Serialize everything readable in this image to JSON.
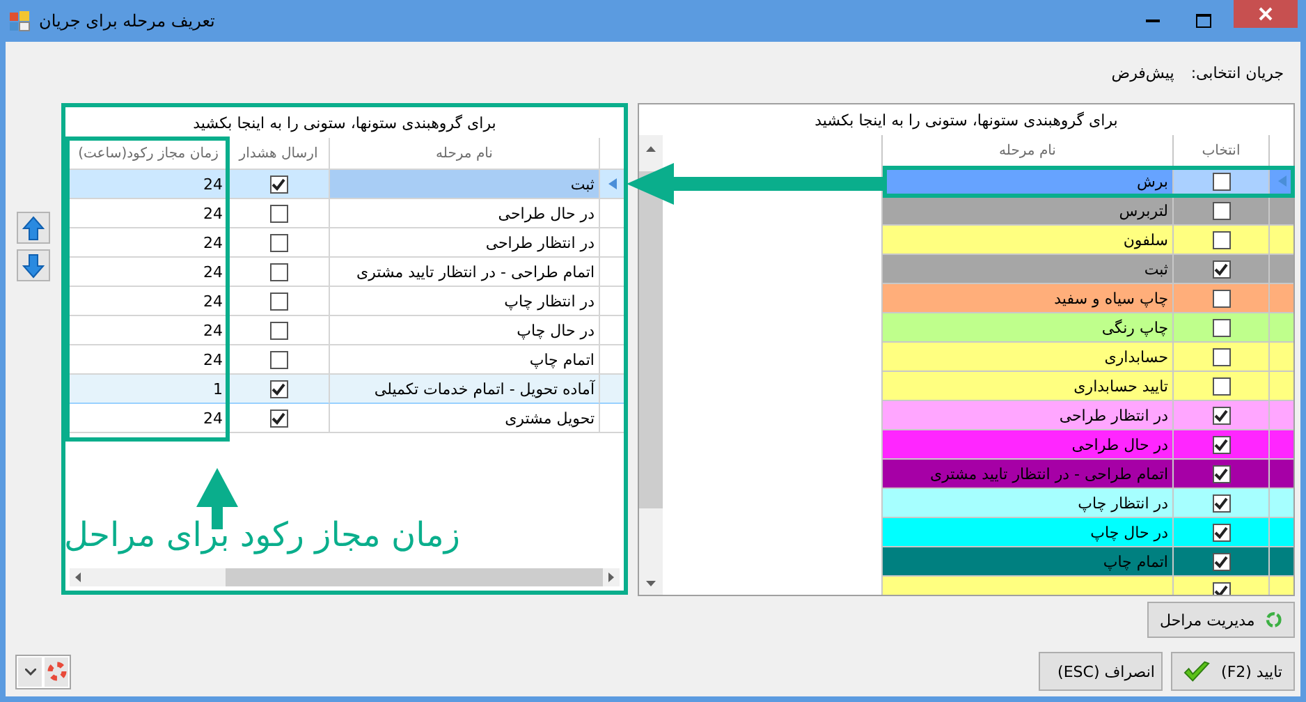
{
  "window": {
    "title": "تعریف مرحله برای جریان"
  },
  "flow": {
    "label": "جریان انتخابی:",
    "value": "پیش‌فرض"
  },
  "stages_grid": {
    "group_hint": "برای گروهبندی ستونها، ستونی را به اینجا بکشید",
    "columns": [
      "نام مرحله",
      "ارسال هشدار",
      "زمان مجاز رکود(ساعت)"
    ],
    "rows": [
      {
        "name": "ثبت",
        "alert": true,
        "hours": "24",
        "selected": true,
        "highlighted": false
      },
      {
        "name": "در حال طراحی",
        "alert": false,
        "hours": "24",
        "selected": false,
        "highlighted": false
      },
      {
        "name": "در انتظار طراحی",
        "alert": false,
        "hours": "24",
        "selected": false,
        "highlighted": false
      },
      {
        "name": "اتمام طراحی - در انتظار تایید مشتری",
        "alert": false,
        "hours": "24",
        "selected": false,
        "highlighted": false
      },
      {
        "name": "در انتظار چاپ",
        "alert": false,
        "hours": "24",
        "selected": false,
        "highlighted": false
      },
      {
        "name": "در حال چاپ",
        "alert": false,
        "hours": "24",
        "selected": false,
        "highlighted": false
      },
      {
        "name": "اتمام چاپ",
        "alert": false,
        "hours": "24",
        "selected": false,
        "highlighted": false
      },
      {
        "name": "آماده تحویل - اتمام خدمات تکمیلی",
        "alert": true,
        "hours": "1",
        "selected": false,
        "highlighted": true
      },
      {
        "name": "تحویل مشتری",
        "alert": true,
        "hours": "24",
        "selected": false,
        "highlighted": false
      }
    ]
  },
  "all_stages_grid": {
    "group_hint": "برای گروهبندی ستونها، ستونی را به اینجا بکشید",
    "columns": [
      "انتخاب",
      "نام مرحله"
    ],
    "rows": [
      {
        "name": "برش",
        "checked": false,
        "color": "#66a3ff",
        "selected": true
      },
      {
        "name": "لتربرس",
        "checked": false,
        "color": "#a6a6a6",
        "selected": false
      },
      {
        "name": "سلفون",
        "checked": false,
        "color": "#ffff80",
        "selected": false
      },
      {
        "name": "ثبت",
        "checked": true,
        "color": "#a6a6a6",
        "selected": false
      },
      {
        "name": "چاپ سیاه و سفید",
        "checked": false,
        "color": "#ffae7a",
        "selected": false
      },
      {
        "name": "چاپ رنگی",
        "checked": false,
        "color": "#bfff8c",
        "selected": false
      },
      {
        "name": "حسابداری",
        "checked": false,
        "color": "#ffff80",
        "selected": false
      },
      {
        "name": "تایید حسابداری",
        "checked": false,
        "color": "#ffff80",
        "selected": false
      },
      {
        "name": "در انتظار طراحی",
        "checked": true,
        "color": "#ffa6ff",
        "selected": false
      },
      {
        "name": "در حال طراحی",
        "checked": true,
        "color": "#ff26ff",
        "selected": false
      },
      {
        "name": "اتمام طراحی - در انتظار تایید مشتری",
        "checked": true,
        "color": "#a600a6",
        "selected": false
      },
      {
        "name": "در انتظار چاپ",
        "checked": true,
        "color": "#a6ffff",
        "selected": false
      },
      {
        "name": "در حال چاپ",
        "checked": true,
        "color": "#00ffff",
        "selected": false
      },
      {
        "name": "اتمام چاپ",
        "checked": true,
        "color": "#008080",
        "selected": false
      },
      {
        "checked": true,
        "color": "#ffff80",
        "selected": false
      }
    ]
  },
  "annotation": {
    "text": "زمان مجاز رکود برای مراحل"
  },
  "manage_button": {
    "label": "مدیریت مراحل"
  },
  "buttons": [
    {
      "label": "تایید (F2)",
      "kind": "confirm"
    },
    {
      "label": "انصراف (ESC)",
      "kind": "cancel"
    }
  ]
}
